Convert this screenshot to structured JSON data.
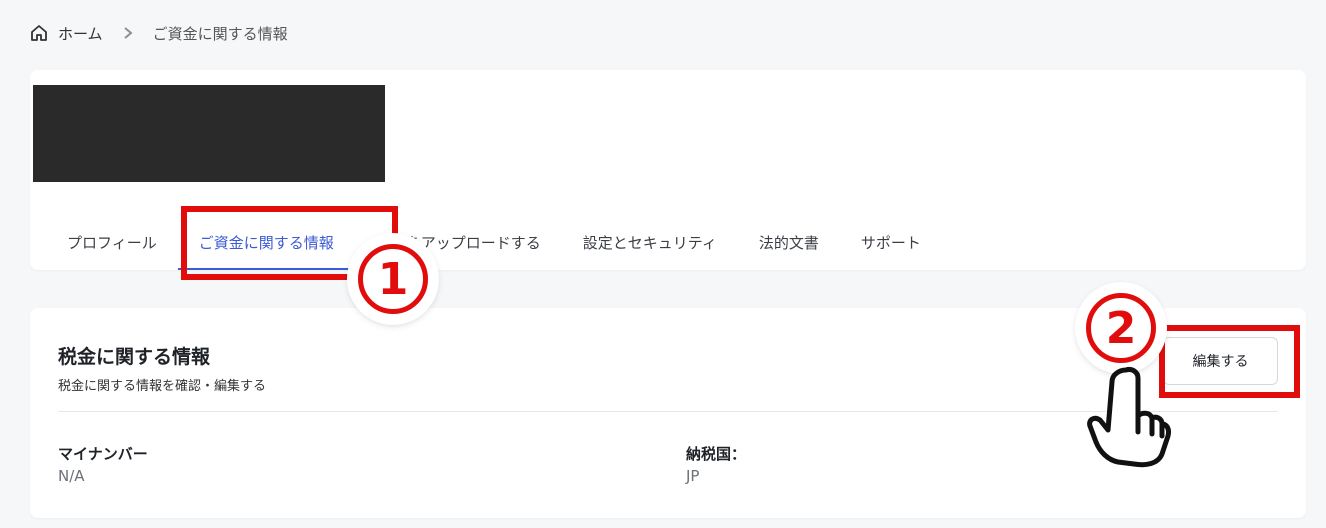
{
  "breadcrumb": {
    "home": "ホーム",
    "current": "ご資金に関する情報"
  },
  "tabs": [
    {
      "label": "プロフィール",
      "active": false
    },
    {
      "label": "ご資金に関する情報",
      "active": true
    },
    {
      "label": "書類をアップロードする",
      "active": false
    },
    {
      "label": "設定とセキュリティ",
      "active": false
    },
    {
      "label": "法的文書",
      "active": false
    },
    {
      "label": "サポート",
      "active": false
    }
  ],
  "tax": {
    "title": "税金に関する情報",
    "subtitle": "税金に関する情報を確認・編集する",
    "edit_label": "編集する",
    "fields": [
      {
        "label": "マイナンバー",
        "value": "N/A"
      },
      {
        "label": "納税国：",
        "value": "JP"
      }
    ]
  },
  "annotations": {
    "step1": "1",
    "step2": "2",
    "highlight_color": "#e10d0d"
  },
  "colors": {
    "accent": "#3b5bd6",
    "background": "#f6f7f9"
  }
}
